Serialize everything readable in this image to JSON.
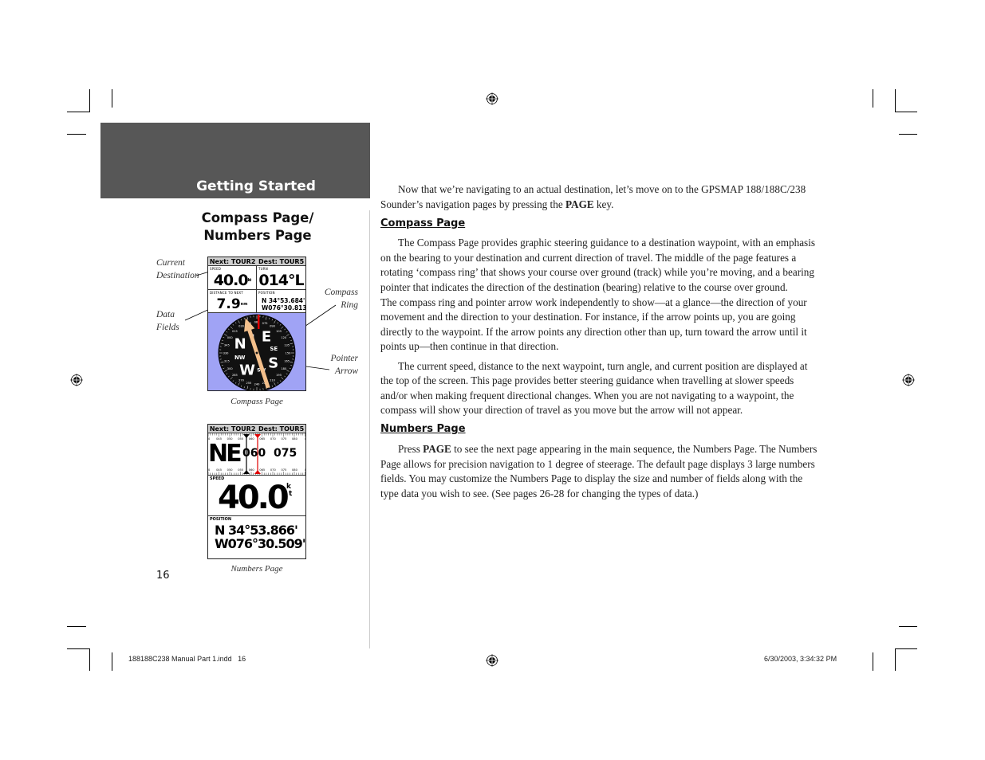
{
  "header": {
    "section_title": "Getting Started"
  },
  "sidebar": {
    "heading_line1": "Compass Page/",
    "heading_line2": "Numbers Page",
    "callouts": {
      "current_destination_line1": "Current",
      "current_destination_line2": "Destination",
      "data_fields_line1": "Data",
      "data_fields_line2": "Fields",
      "compass_ring_line1": "Compass",
      "compass_ring_line2": "Ring",
      "pointer_arrow_line1": "Pointer",
      "pointer_arrow_line2": "Arrow"
    },
    "compass_screen": {
      "next_label": "Next: TOUR2",
      "dest_label": "Dest: TOUR5",
      "fields": [
        {
          "label": "SPEED",
          "value": "40.0",
          "unit": "kt"
        },
        {
          "label": "TURN",
          "value": "014°L",
          "unit": ""
        },
        {
          "label": "DISTANCE TO NEXT",
          "value": "7.9",
          "unit": "nm"
        },
        {
          "label": "POSITION",
          "value_line1": "N  34°53.684'",
          "value_line2": "W076°30.813'"
        }
      ],
      "ring_letters": {
        "n": "N",
        "ne": "N",
        "e": "E",
        "se": "SE",
        "s": "S",
        "sw": "SW",
        "w": "W",
        "nw": "NW"
      },
      "ring_ticks": [
        "060",
        "075",
        "090",
        "105",
        "120",
        "135",
        "150",
        "165",
        "180",
        "195",
        "210",
        "225",
        "240",
        "255",
        "270",
        "285",
        "300",
        "315",
        "330",
        "345",
        "000",
        "015",
        "030",
        "045"
      ],
      "caption": "Compass Page"
    },
    "numbers_screen": {
      "next_label": "Next: TOUR2",
      "dest_label": "Dest: TOUR5",
      "tape_ticks": [
        "40",
        "045",
        "050",
        "055",
        "060",
        "065",
        "070",
        "075",
        "080",
        "0"
      ],
      "heading_letters": "NE",
      "track_value": "060",
      "bearing_value": "075",
      "speed_label": "SPEED",
      "speed_value": "40.0",
      "speed_unit_top": "k",
      "speed_unit_bottom": "t",
      "position_label": "POSITION",
      "position_line1": "N  34°53.866'",
      "position_line2": "W076°30.509'",
      "caption": "Numbers Page"
    },
    "page_number": "16"
  },
  "body": {
    "intro_part1": "Now that we’re navigating to an actual destination, let’s move on to the GPSMAP 188/188C/238 Sounder’s navigation pages by pressing the ",
    "intro_key": "PAGE",
    "intro_part2": " key.",
    "compass_heading": "Compass Page",
    "compass_p1": "The Compass Page provides graphic steering guidance to a destination waypoint, with an emphasis on the bearing to your destination and current direction of travel. The middle of the page features a rotating ‘compass ring’ that shows your course over ground (track) while you’re moving, and a bearing pointer that indicates the direction of the destination (bearing) relative to the course over ground.",
    "compass_p1b": "The compass ring and pointer arrow work independently to show—at a glance—the direction of your movement and the direction to your destination. For instance, if the arrow points up, you are going directly to the waypoint. If the arrow points any direction other than up, turn toward the arrow until it points up—then continue in that direction.",
    "compass_p2": "The current speed, distance to the next waypoint, turn angle, and current position are displayed at the top of the screen. This page provides better steering guidance when travelling at slower speeds and/or when making frequent directional changes. When you are not navigating to a waypoint, the compass will show your direction of travel as you move but the arrow will not appear.",
    "numbers_heading": "Numbers Page",
    "numbers_part1": "Press ",
    "numbers_key": "PAGE",
    "numbers_part2": " to see the next page appearing in the main sequence, the Numbers Page. The Numbers Page allows for precision navigation to 1 degree of steerage. The default page displays 3 large numbers fields. You may customize the Numbers Page to display the size and number of fields along with the type data you wish to see. (See pages 26-28 for changing the types of data.)"
  },
  "footer": {
    "file_info": "188188C238 Manual Part 1.indd   16",
    "timestamp": "6/30/2003, 3:34:32 PM"
  }
}
